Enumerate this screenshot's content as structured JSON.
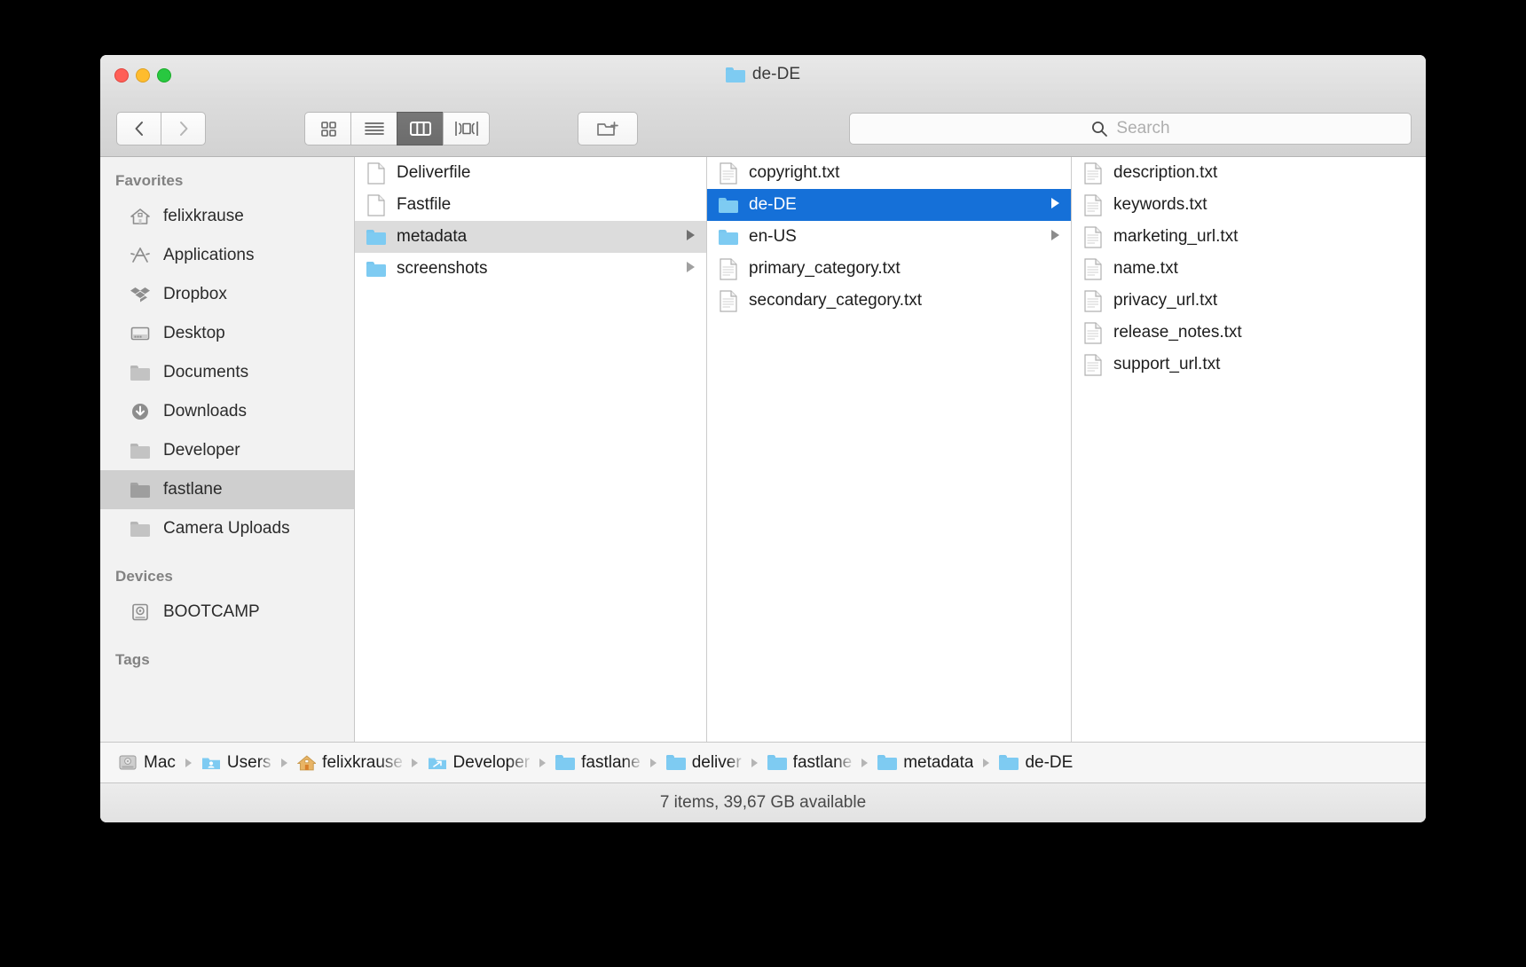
{
  "window": {
    "title": "de-DE",
    "title_icon": "folder-icon",
    "traffic_lights": [
      {
        "name": "close",
        "color": "#ff5f57"
      },
      {
        "name": "minimize",
        "color": "#febc2e"
      },
      {
        "name": "maximize",
        "color": "#28c840"
      }
    ]
  },
  "toolbar": {
    "back_icon": "chevron-left-icon",
    "forward_icon": "chevron-right-icon",
    "views": [
      {
        "name": "icon-view",
        "icon": "grid-icon",
        "active": false
      },
      {
        "name": "list-view",
        "icon": "lines-icon",
        "active": false
      },
      {
        "name": "column-view",
        "icon": "columns-icon",
        "active": true
      },
      {
        "name": "coverflow-view",
        "icon": "coverflow-icon",
        "active": false
      }
    ],
    "new_folder_icon": "new-folder-icon"
  },
  "search": {
    "icon": "search-icon",
    "placeholder": "Search",
    "value": ""
  },
  "sidebar": {
    "sections": [
      {
        "header": "Favorites",
        "items": [
          {
            "label": "felixkrause",
            "icon": "home-icon",
            "selected": false
          },
          {
            "label": "Applications",
            "icon": "applications-icon",
            "selected": false
          },
          {
            "label": "Dropbox",
            "icon": "dropbox-icon",
            "selected": false
          },
          {
            "label": "Desktop",
            "icon": "desktop-icon",
            "selected": false
          },
          {
            "label": "Documents",
            "icon": "folder-icon",
            "selected": false
          },
          {
            "label": "Downloads",
            "icon": "download-icon",
            "selected": false
          },
          {
            "label": "Developer",
            "icon": "folder-icon",
            "selected": false
          },
          {
            "label": "fastlane",
            "icon": "folder-icon",
            "selected": true
          },
          {
            "label": "Camera Uploads",
            "icon": "folder-icon",
            "selected": false
          }
        ]
      },
      {
        "header": "Devices",
        "items": [
          {
            "label": "BOOTCAMP",
            "icon": "harddisk-icon",
            "selected": false
          }
        ]
      },
      {
        "header": "Tags",
        "items": []
      }
    ]
  },
  "columns": [
    {
      "name": "column-1",
      "items": [
        {
          "label": "Deliverfile",
          "type": "file",
          "selected": false,
          "disclosure": false
        },
        {
          "label": "Fastfile",
          "type": "file",
          "selected": false,
          "disclosure": false
        },
        {
          "label": "metadata",
          "type": "folder",
          "selected": "grey",
          "disclosure": true
        },
        {
          "label": "screenshots",
          "type": "folder",
          "selected": false,
          "disclosure": true
        }
      ]
    },
    {
      "name": "column-2",
      "items": [
        {
          "label": "copyright.txt",
          "type": "file",
          "selected": false,
          "disclosure": false
        },
        {
          "label": "de-DE",
          "type": "folder",
          "selected": "blue",
          "disclosure": true
        },
        {
          "label": "en-US",
          "type": "folder",
          "selected": false,
          "disclosure": true
        },
        {
          "label": "primary_category.txt",
          "type": "file",
          "selected": false,
          "disclosure": false
        },
        {
          "label": "secondary_category.txt",
          "type": "file",
          "selected": false,
          "disclosure": false
        }
      ]
    },
    {
      "name": "column-3",
      "items": [
        {
          "label": "description.txt",
          "type": "file",
          "selected": false,
          "disclosure": false
        },
        {
          "label": "keywords.txt",
          "type": "file",
          "selected": false,
          "disclosure": false
        },
        {
          "label": "marketing_url.txt",
          "type": "file",
          "selected": false,
          "disclosure": false
        },
        {
          "label": "name.txt",
          "type": "file",
          "selected": false,
          "disclosure": false
        },
        {
          "label": "privacy_url.txt",
          "type": "file",
          "selected": false,
          "disclosure": false
        },
        {
          "label": "release_notes.txt",
          "type": "file",
          "selected": false,
          "disclosure": false
        },
        {
          "label": "support_url.txt",
          "type": "file",
          "selected": false,
          "disclosure": false
        }
      ]
    }
  ],
  "pathbar": {
    "segments": [
      {
        "label": "Mac",
        "icon": "harddisk-icon",
        "truncated": false
      },
      {
        "label": "Users",
        "icon": "users-folder-icon",
        "truncated": true
      },
      {
        "label": "felixkrause",
        "icon": "home-icon",
        "truncated": true
      },
      {
        "label": "Developer",
        "icon": "developer-folder-icon",
        "truncated": true
      },
      {
        "label": "fastlane",
        "icon": "folder-icon",
        "truncated": true
      },
      {
        "label": "deliver",
        "icon": "folder-icon",
        "truncated": true
      },
      {
        "label": "fastlane",
        "icon": "folder-icon",
        "truncated": true
      },
      {
        "label": "metadata",
        "icon": "folder-icon",
        "truncated": false
      },
      {
        "label": "de-DE",
        "icon": "folder-icon",
        "truncated": false
      }
    ],
    "separator_icon": "chevron-right-small-icon"
  },
  "statusbar": {
    "text": "7 items, 39,67 GB available"
  },
  "colors": {
    "selection_blue": "#1570d8",
    "selection_grey": "#dcdcdc",
    "folder_blue": "#7ecbf2",
    "sidebar_bg": "#f2f2f2"
  }
}
